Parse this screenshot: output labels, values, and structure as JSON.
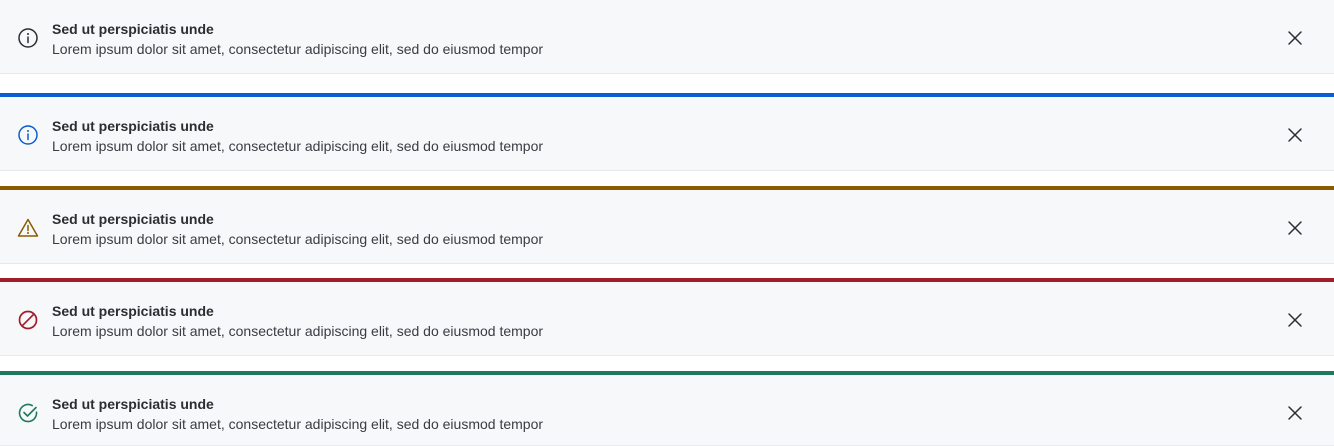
{
  "banners": [
    {
      "variant": "neutral",
      "icon": "info-circle-icon",
      "color": "#2b2d31",
      "accent": null,
      "title": "Sed ut perspiciatis unde",
      "body": "Lorem ipsum dolor sit amet, consectetur adipiscing elit, sed do eiusmod tempor"
    },
    {
      "variant": "info",
      "icon": "info-circle-icon",
      "color": "#0b5cd5",
      "accent": "#0b5cd5",
      "title": "Sed ut perspiciatis unde",
      "body": "Lorem ipsum dolor sit amet, consectetur adipiscing elit, sed do eiusmod tempor"
    },
    {
      "variant": "warning",
      "icon": "warning-triangle-icon",
      "color": "#8a5c00",
      "accent": "#8a5c00",
      "title": "Sed ut perspiciatis unde",
      "body": "Lorem ipsum dolor sit amet, consectetur adipiscing elit, sed do eiusmod tempor"
    },
    {
      "variant": "error",
      "icon": "prohibited-icon",
      "color": "#a11d2b",
      "accent": "#a11d2b",
      "title": "Sed ut perspiciatis unde",
      "body": "Lorem ipsum dolor sit amet, consectetur adipiscing elit, sed do eiusmod tempor"
    },
    {
      "variant": "success",
      "icon": "check-circle-icon",
      "color": "#1e7a5a",
      "accent": "#1e7a5a",
      "title": "Sed ut perspiciatis unde",
      "body": "Lorem ipsum dolor sit amet, consectetur adipiscing elit, sed do eiusmod tempor"
    }
  ],
  "close_icon": "close-icon"
}
